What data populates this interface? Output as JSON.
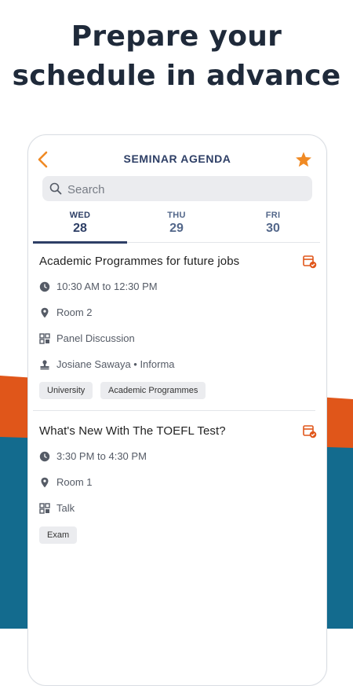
{
  "headline": {
    "line1": "Prepare your",
    "line2": "schedule in advance"
  },
  "colors": {
    "accent_orange": "#f08a24",
    "navy": "#2e3f66",
    "bg_orange": "#e0561a",
    "bg_teal": "#136b8e"
  },
  "app": {
    "title": "SEMINAR AGENDA",
    "back_icon": "chevron-left-icon",
    "star_icon": "star-icon",
    "search": {
      "placeholder": "Search"
    },
    "tabs": [
      {
        "day": "WED",
        "date": "28",
        "active": true
      },
      {
        "day": "THU",
        "date": "29",
        "active": false
      },
      {
        "day": "FRI",
        "date": "30",
        "active": false
      }
    ],
    "sessions": [
      {
        "title": "Academic Programmes for future jobs",
        "time": "10:30 AM to 12:30 PM",
        "room": "Room 2",
        "type": "Panel Discussion",
        "speaker": "Josiane Sawaya • Informa",
        "tags": [
          "University",
          "Academic Programmes"
        ]
      },
      {
        "title": "What's New With The TOEFL Test?",
        "time": "3:30 PM to 4:30 PM",
        "room": "Room 1",
        "type": "Talk",
        "tags": [
          "Exam"
        ]
      }
    ]
  }
}
